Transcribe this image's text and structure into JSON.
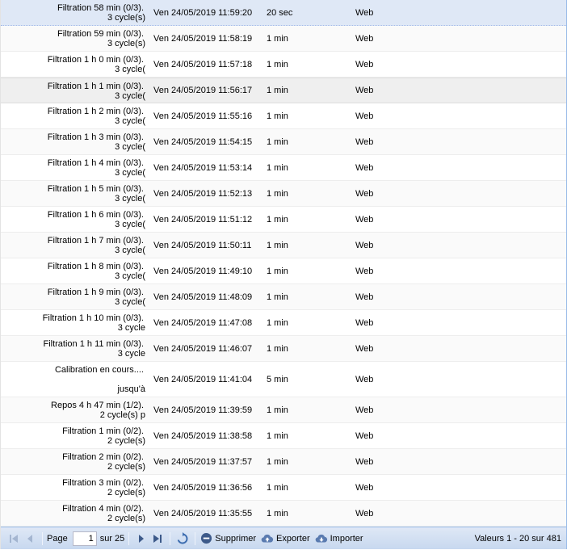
{
  "rows": [
    {
      "desc_line1": "Filtration 58 min (0/3).",
      "desc_line2": "3 cycle(s)",
      "date": "Ven 24/05/2019 11:59:20",
      "duration": "20 sec",
      "source": "Web"
    },
    {
      "desc_line1": "Filtration 59 min (0/3).",
      "desc_line2": "3 cycle(s)",
      "date": "Ven 24/05/2019 11:58:19",
      "duration": "1 min",
      "source": "Web"
    },
    {
      "desc_line1": "Filtration 1 h 0 min (0/3).",
      "desc_line2": "3 cycle(",
      "date": "Ven 24/05/2019 11:57:18",
      "duration": "1 min",
      "source": "Web"
    },
    {
      "desc_line1": "Filtration 1 h 1 min (0/3).",
      "desc_line2": "3 cycle(",
      "date": "Ven 24/05/2019 11:56:17",
      "duration": "1 min",
      "source": "Web"
    },
    {
      "desc_line1": "Filtration 1 h 2 min (0/3).",
      "desc_line2": "3 cycle(",
      "date": "Ven 24/05/2019 11:55:16",
      "duration": "1 min",
      "source": "Web"
    },
    {
      "desc_line1": "Filtration 1 h 3 min (0/3).",
      "desc_line2": "3 cycle(",
      "date": "Ven 24/05/2019 11:54:15",
      "duration": "1 min",
      "source": "Web"
    },
    {
      "desc_line1": "Filtration 1 h 4 min (0/3).",
      "desc_line2": "3 cycle(",
      "date": "Ven 24/05/2019 11:53:14",
      "duration": "1 min",
      "source": "Web"
    },
    {
      "desc_line1": "Filtration 1 h 5 min (0/3).",
      "desc_line2": "3 cycle(",
      "date": "Ven 24/05/2019 11:52:13",
      "duration": "1 min",
      "source": "Web"
    },
    {
      "desc_line1": "Filtration 1 h 6 min (0/3).",
      "desc_line2": "3 cycle(",
      "date": "Ven 24/05/2019 11:51:12",
      "duration": "1 min",
      "source": "Web"
    },
    {
      "desc_line1": "Filtration 1 h 7 min (0/3).",
      "desc_line2": "3 cycle(",
      "date": "Ven 24/05/2019 11:50:11",
      "duration": "1 min",
      "source": "Web"
    },
    {
      "desc_line1": "Filtration 1 h 8 min (0/3).",
      "desc_line2": "3 cycle(",
      "date": "Ven 24/05/2019 11:49:10",
      "duration": "1 min",
      "source": "Web"
    },
    {
      "desc_line1": "Filtration 1 h 9 min (0/3).",
      "desc_line2": "3 cycle(",
      "date": "Ven 24/05/2019 11:48:09",
      "duration": "1 min",
      "source": "Web"
    },
    {
      "desc_line1": "Filtration 1 h 10 min (0/3).",
      "desc_line2": "3 cycle",
      "date": "Ven 24/05/2019 11:47:08",
      "duration": "1 min",
      "source": "Web"
    },
    {
      "desc_line1": "Filtration 1 h 11 min (0/3).",
      "desc_line2": "3 cycle",
      "date": "Ven 24/05/2019 11:46:07",
      "duration": "1 min",
      "source": "Web"
    },
    {
      "desc_line1": "Calibration en cours....",
      "desc_line2": "jusqu'à",
      "date": "Ven 24/05/2019 11:41:04",
      "duration": "5 min",
      "source": "Web"
    },
    {
      "desc_line1": "Repos 4 h 47 min (1/2).",
      "desc_line2": "2 cycle(s) p",
      "date": "Ven 24/05/2019 11:39:59",
      "duration": "1 min",
      "source": "Web"
    },
    {
      "desc_line1": "Filtration 1 min (0/2).",
      "desc_line2": "2 cycle(s)",
      "date": "Ven 24/05/2019 11:38:58",
      "duration": "1 min",
      "source": "Web"
    },
    {
      "desc_line1": "Filtration 2 min (0/2).",
      "desc_line2": "2 cycle(s)",
      "date": "Ven 24/05/2019 11:37:57",
      "duration": "1 min",
      "source": "Web"
    },
    {
      "desc_line1": "Filtration 3 min (0/2).",
      "desc_line2": "2 cycle(s)",
      "date": "Ven 24/05/2019 11:36:56",
      "duration": "1 min",
      "source": "Web"
    },
    {
      "desc_line1": "Filtration 4 min (0/2).",
      "desc_line2": "2 cycle(s)",
      "date": "Ven 24/05/2019 11:35:55",
      "duration": "1 min",
      "source": "Web"
    }
  ],
  "toolbar": {
    "page_label": "Page",
    "page_value": "1",
    "page_of": "sur 25",
    "delete_label": "Supprimer",
    "export_label": "Exporter",
    "import_label": "Importer",
    "status_text": "Valeurs 1 - 20 sur 481"
  },
  "colors": {
    "selected_row": "#dfe8f6",
    "toolbar_top": "#dfe8f6",
    "toolbar_bottom": "#c7d8ef",
    "delete_icon": "#3d5a8a",
    "cloud_icon": "#5a7bb0"
  },
  "icons": {
    "first": "first-page-icon",
    "prev": "prev-page-icon",
    "next": "next-page-icon",
    "last": "last-page-icon",
    "refresh": "refresh-icon",
    "delete": "minus-circle-icon",
    "export": "cloud-upload-icon",
    "import": "cloud-download-icon"
  }
}
